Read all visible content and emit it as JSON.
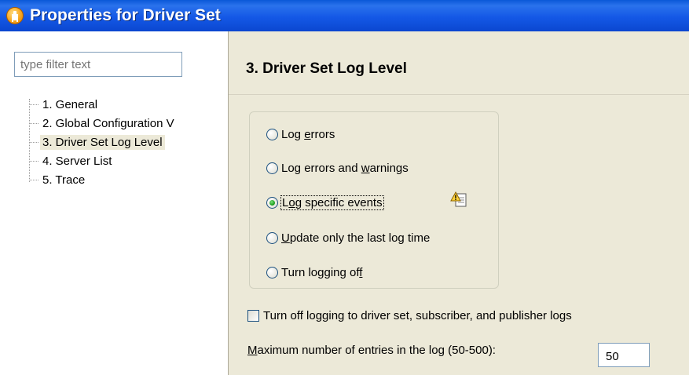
{
  "window": {
    "title": "Properties for Driver Set"
  },
  "filter": {
    "placeholder": "type filter text"
  },
  "tree": {
    "items": [
      {
        "label": "1. General"
      },
      {
        "label": "2. Global Configuration V"
      },
      {
        "label": "3. Driver Set Log Level"
      },
      {
        "label": "4. Server List"
      },
      {
        "label": "5. Trace"
      }
    ],
    "selected_index": 2
  },
  "page": {
    "title": "3. Driver Set Log Level",
    "log_options": {
      "items": [
        {
          "pre": "Log ",
          "mnemonic": "e",
          "post": "rrors"
        },
        {
          "pre": "Log errors and ",
          "mnemonic": "w",
          "post": "arnings"
        },
        {
          "pre": "L",
          "mnemonic": "o",
          "post": "g specific events"
        },
        {
          "pre": "",
          "mnemonic": "U",
          "post": "pdate only the last log time"
        },
        {
          "pre": "Turn logging of",
          "mnemonic": "f",
          "post": ""
        }
      ],
      "selected_index": 2
    },
    "disable_logs": {
      "label": "Turn off logging to driver set, subscriber, and publisher logs",
      "checked": false
    },
    "max_entries": {
      "label_pre": "",
      "label_mnemonic": "M",
      "label_post": "aximum number of entries in the log (50-500):",
      "value": "50"
    }
  },
  "icons": {
    "app": "novell-app-icon",
    "warning": "warning-note-icon"
  }
}
